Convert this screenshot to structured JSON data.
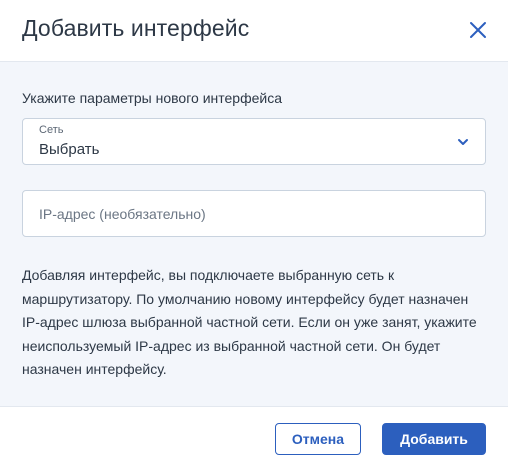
{
  "dialog": {
    "title": "Добавить интерфейс",
    "close_icon": "close-icon"
  },
  "form": {
    "intro": "Укажите параметры нового интерфейса",
    "network_select": {
      "label": "Сеть",
      "value": "Выбрать",
      "icon": "chevron-down-icon"
    },
    "ip_input": {
      "placeholder": "IP-адрес (необязательно)",
      "value": ""
    },
    "help_text": "Добавляя интерфейс, вы подключаете выбранную сеть к маршрутизатору. По умолчанию новому интерфейсу будет назначен IP-адрес шлюза выбранной частной сети. Если он уже занят, укажите неиспользуемый IP-адрес из выбранной частной сети. Он будет назначен интерфейсу."
  },
  "footer": {
    "cancel_label": "Отмена",
    "add_label": "Добавить"
  },
  "colors": {
    "accent": "#2c5fbe",
    "body_background": "#f3f6fb",
    "text": "#2d3846",
    "border": "#c9d3df"
  }
}
